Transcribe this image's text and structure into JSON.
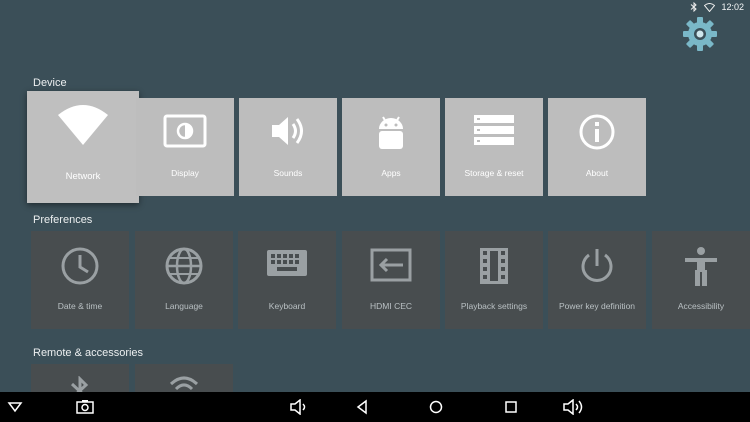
{
  "theme": {
    "background": "#3b4f58",
    "tile_light": "#bdbdbd",
    "tile_dark": "#484d4f"
  },
  "status": {
    "time": "12:02",
    "icons": [
      "bluetooth-icon",
      "wifi-icon"
    ]
  },
  "sections": {
    "device": {
      "title": "Device",
      "items": [
        {
          "label": "Network",
          "icon": "wifi-icon"
        },
        {
          "label": "Display",
          "icon": "display-icon"
        },
        {
          "label": "Sounds",
          "icon": "volume-icon"
        },
        {
          "label": "Apps",
          "icon": "android-icon"
        },
        {
          "label": "Storage & reset",
          "icon": "storage-icon"
        },
        {
          "label": "About",
          "icon": "info-icon"
        }
      ]
    },
    "preferences": {
      "title": "Preferences",
      "items": [
        {
          "label": "Date & time",
          "icon": "clock-icon"
        },
        {
          "label": "Language",
          "icon": "globe-icon"
        },
        {
          "label": "Keyboard",
          "icon": "keyboard-icon"
        },
        {
          "label": "HDMI CEC",
          "icon": "input-icon"
        },
        {
          "label": "Playback settings",
          "icon": "film-icon"
        },
        {
          "label": "Power key definition",
          "icon": "power-icon"
        },
        {
          "label": "Accessibility",
          "icon": "accessibility-icon"
        }
      ]
    },
    "remote": {
      "title": "Remote & accessories",
      "items": [
        {
          "icon": "bluetooth-icon"
        },
        {
          "icon": "wifi-remote-icon"
        }
      ]
    }
  },
  "navbar": [
    "collapse-icon",
    "screenshot-icon",
    "volume-down-icon",
    "back-icon",
    "home-icon",
    "recents-icon",
    "volume-up-icon"
  ]
}
